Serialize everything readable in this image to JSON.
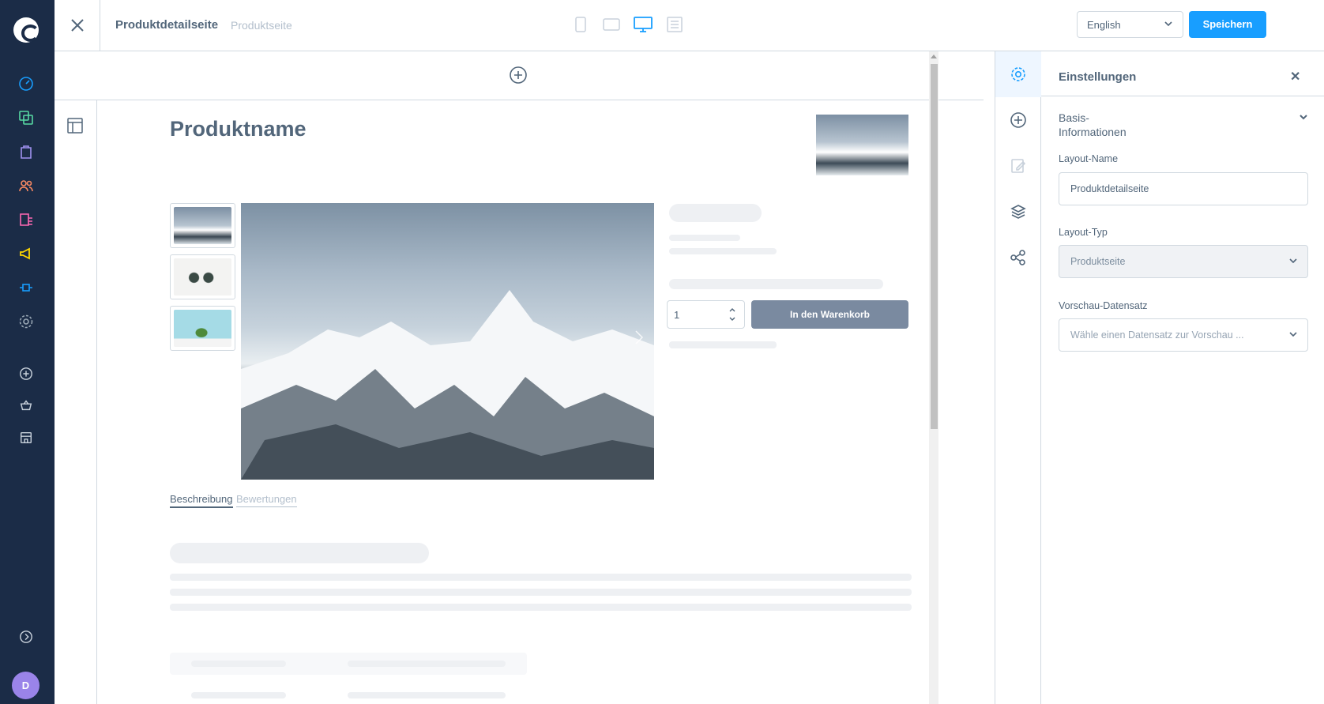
{
  "header": {
    "title": "Produktdetailseite",
    "subtitle": "Produktseite",
    "language": "English",
    "save_label": "Speichern"
  },
  "user": {
    "initial": "D"
  },
  "content": {
    "product_name": "Produktname",
    "quantity": "1",
    "cart_label": "In den Warenkorb",
    "tabs": [
      "Beschreibung",
      "Bewertungen"
    ]
  },
  "settings": {
    "title": "Einstellungen",
    "section": "Basis-Informationen",
    "layout_name_label": "Layout-Name",
    "layout_name_value": "Produktdetailseite",
    "layout_type_label": "Layout-Typ",
    "layout_type_value": "Produktseite",
    "preview_label": "Vorschau-Datensatz",
    "preview_placeholder": "Wähle einen Datensatz zur Vorschau ..."
  },
  "colors": {
    "primary": "#189eff",
    "nav": "#1b2c47",
    "cart": "#7a8aa0"
  },
  "icons": [
    "dashboard-icon",
    "catalog-icon",
    "orders-icon",
    "customers-icon",
    "content-icon",
    "marketing-icon",
    "extensions-icon",
    "settings-icon",
    "plus-circle-icon",
    "basket-icon",
    "storefront-icon",
    "collapse-icon"
  ]
}
